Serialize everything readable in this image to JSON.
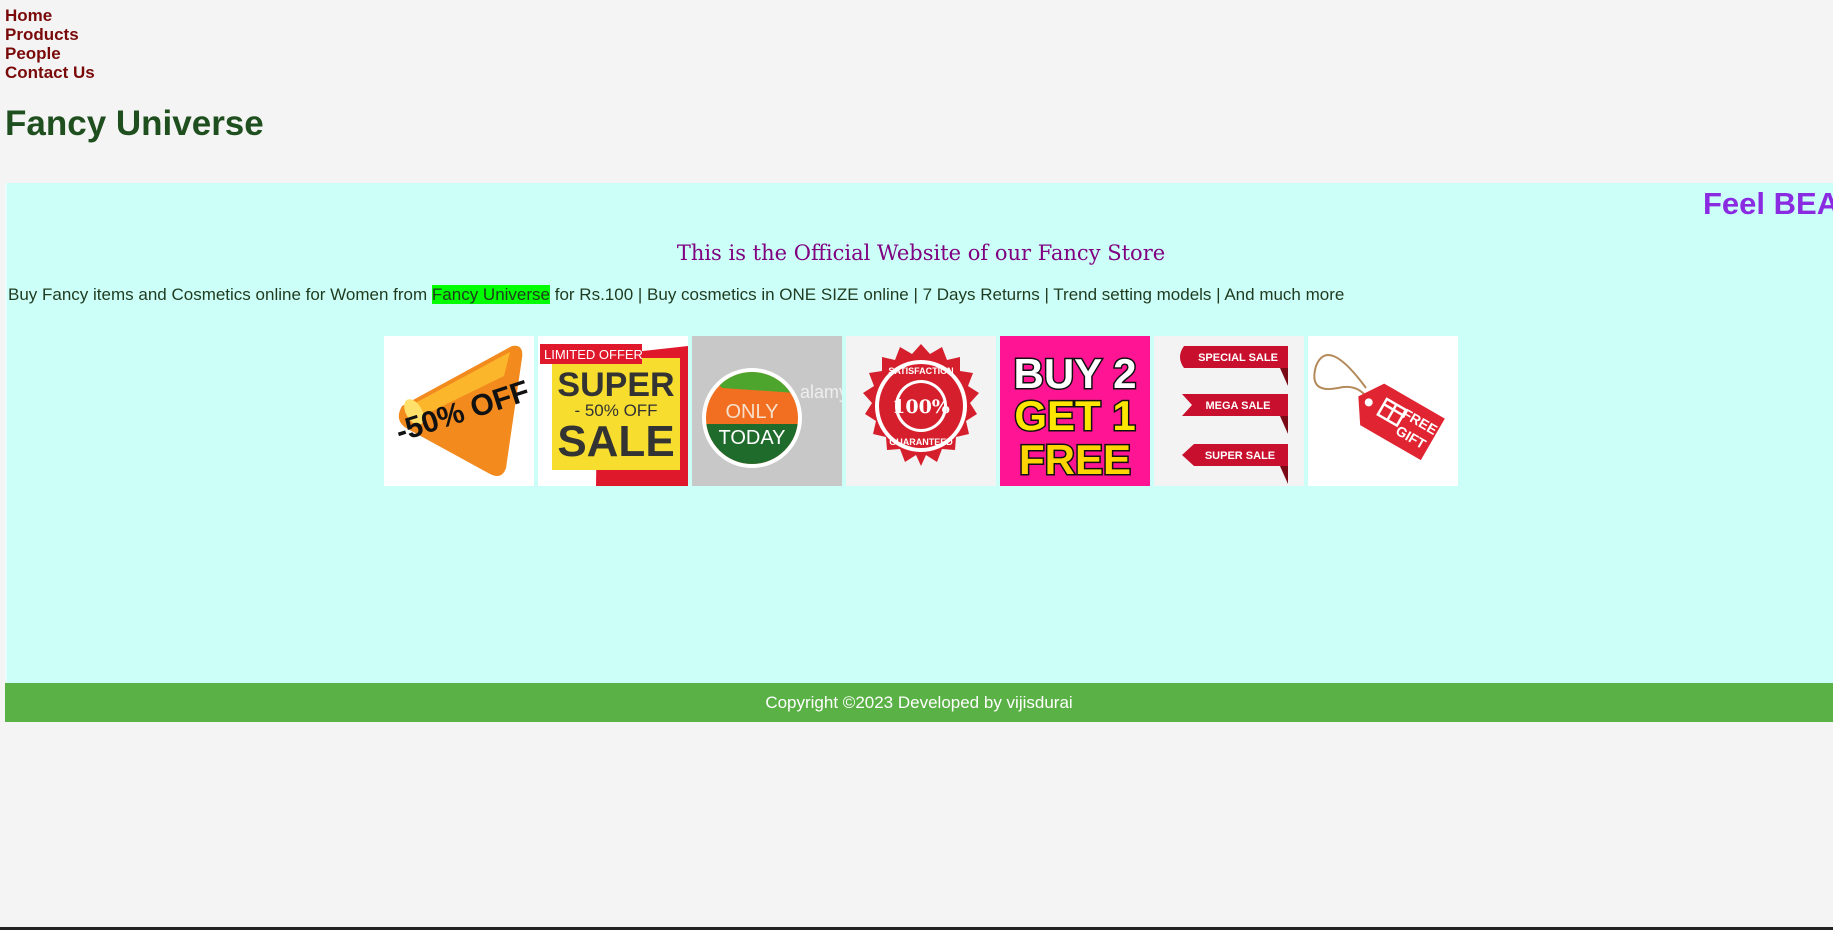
{
  "nav": {
    "items": [
      "Home",
      "Products",
      "People",
      "Contact Us"
    ]
  },
  "brand": {
    "title": "Fancy Universe"
  },
  "banner": {
    "marquee": "Feel BEA",
    "subtitle": "This is the Official Website of our Fancy Store",
    "desc_before": "Buy Fancy items and Cosmetics online for Women from ",
    "desc_highlight": "Fancy Universe",
    "desc_after": " for Rs.100 | Buy cosmetics in ONE SIZE online | 7 Days Returns | Trend setting models | And much more"
  },
  "promos": {
    "p1": "-50% OFF",
    "p2": {
      "ribbon": "LIMITED OFFER",
      "line1": "SUPER",
      "line2": "- 50% OFF",
      "line3": "SALE"
    },
    "p3": {
      "line1": "ONLY",
      "line2": "TODAY",
      "watermark": "alamy"
    },
    "p4": {
      "top": "SATISFACTION",
      "center": "100%",
      "bottom": "GUARANTEED"
    },
    "p5": {
      "line1": "BUY 2",
      "line2": "GET 1",
      "line3": "FREE"
    },
    "p6": [
      "SPECIAL SALE",
      "MEGA SALE",
      "SUPER SALE"
    ],
    "p7": {
      "line1": "FREE",
      "line2": "GIFT"
    }
  },
  "footer": {
    "text": "Copyright ©2023 Developed by vijisdurai"
  },
  "colors": {
    "nav": "#7a0a0a",
    "brand": "#1f4f1f",
    "panel": "#ccfff8",
    "marquee": "#8a2be2",
    "subtitle": "#800080",
    "highlight": "#00ff00",
    "footer": "#5ab145"
  }
}
